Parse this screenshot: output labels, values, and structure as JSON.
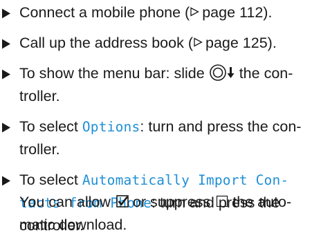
{
  "steps": [
    {
      "lines": [
        {
          "t1": "Connect a mobile phone (",
          "t2": "page 112)."
        }
      ]
    },
    {
      "lines": [
        {
          "t1": "Call up the address book (",
          "t2": "page 125)."
        }
      ]
    },
    {
      "lines": [
        {
          "t1": "To show the menu bar: slide",
          "t2": "the con-"
        },
        {
          "t1": "troller."
        }
      ]
    },
    {
      "lines": [
        {
          "t1": "To select ",
          "m1": "Options",
          "t2": ": turn and press the con-"
        },
        {
          "t1": "troller."
        }
      ]
    },
    {
      "lines": [
        {
          "t1": "To select ",
          "m1": "Automatically Import Con-"
        },
        {
          "m1": "tacts from Phone",
          "t2": ": turn and press the"
        },
        {
          "t1": "controller."
        },
        {
          "t1": "You can allow",
          "t2": "or suppress",
          "t3": "the auto-"
        },
        {
          "t1": "matic download."
        }
      ]
    }
  ],
  "icons": {
    "bullet": "triangle-bullet",
    "page_reference": "outline-triangle-reference",
    "controller_slide": "controller-slide-down",
    "checkbox_checked": "checkbox-checked",
    "checkbox_empty": "checkbox-empty"
  },
  "colors": {
    "text": "#1a1a1a",
    "display_text": "#1f8fd6"
  }
}
